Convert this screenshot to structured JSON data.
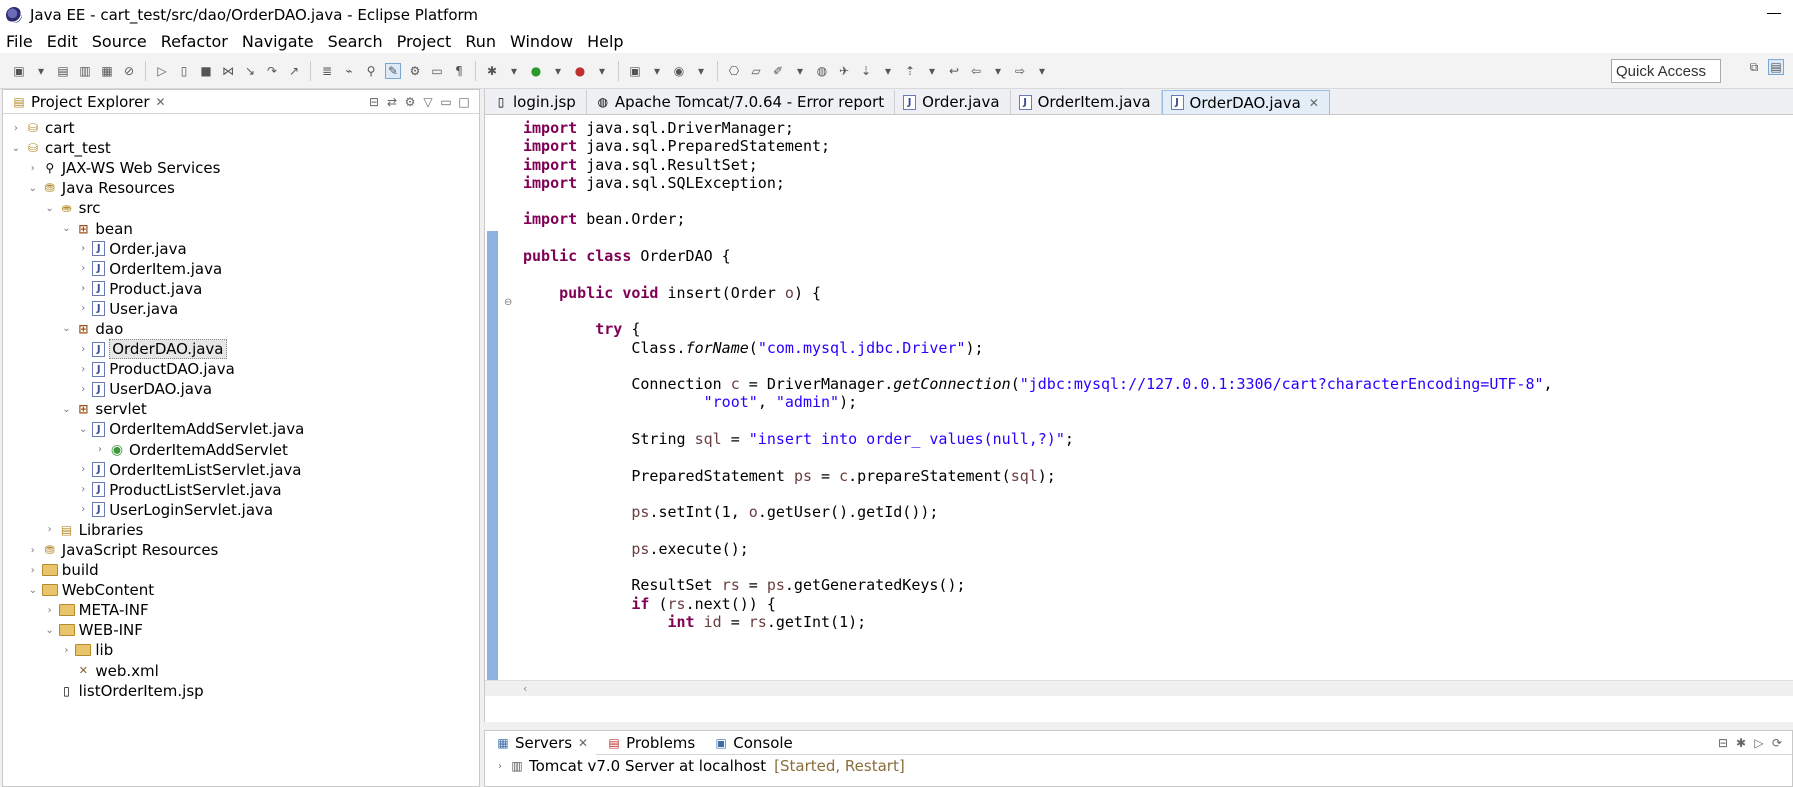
{
  "window": {
    "title": "Java EE - cart_test/src/dao/OrderDAO.java - Eclipse Platform"
  },
  "menu": [
    "File",
    "Edit",
    "Source",
    "Refactor",
    "Navigate",
    "Search",
    "Project",
    "Run",
    "Window",
    "Help"
  ],
  "toolbar": {
    "quick_access": "Quick Access"
  },
  "explorer": {
    "title": "Project Explorer",
    "tree": [
      {
        "label": "cart",
        "depth": 0,
        "toggle": "›",
        "icon": "project"
      },
      {
        "label": "cart_test",
        "depth": 0,
        "toggle": "⌄",
        "icon": "project"
      },
      {
        "label": "JAX-WS Web Services",
        "depth": 1,
        "toggle": "›",
        "icon": "webservice"
      },
      {
        "label": "Java Resources",
        "depth": 1,
        "toggle": "⌄",
        "icon": "resources"
      },
      {
        "label": "src",
        "depth": 2,
        "toggle": "⌄",
        "icon": "srcfolder"
      },
      {
        "label": "bean",
        "depth": 3,
        "toggle": "⌄",
        "icon": "package"
      },
      {
        "label": "Order.java",
        "depth": 4,
        "toggle": "›",
        "icon": "java"
      },
      {
        "label": "OrderItem.java",
        "depth": 4,
        "toggle": "›",
        "icon": "java"
      },
      {
        "label": "Product.java",
        "depth": 4,
        "toggle": "›",
        "icon": "java"
      },
      {
        "label": "User.java",
        "depth": 4,
        "toggle": "›",
        "icon": "java"
      },
      {
        "label": "dao",
        "depth": 3,
        "toggle": "⌄",
        "icon": "package"
      },
      {
        "label": "OrderDAO.java",
        "depth": 4,
        "toggle": "›",
        "icon": "java",
        "selected": true
      },
      {
        "label": "ProductDAO.java",
        "depth": 4,
        "toggle": "›",
        "icon": "java"
      },
      {
        "label": "UserDAO.java",
        "depth": 4,
        "toggle": "›",
        "icon": "java"
      },
      {
        "label": "servlet",
        "depth": 3,
        "toggle": "⌄",
        "icon": "package"
      },
      {
        "label": "OrderItemAddServlet.java",
        "depth": 4,
        "toggle": "⌄",
        "icon": "java"
      },
      {
        "label": "OrderItemAddServlet",
        "depth": 5,
        "toggle": "›",
        "icon": "class"
      },
      {
        "label": "OrderItemListServlet.java",
        "depth": 4,
        "toggle": "›",
        "icon": "java"
      },
      {
        "label": "ProductListServlet.java",
        "depth": 4,
        "toggle": "›",
        "icon": "java"
      },
      {
        "label": "UserLoginServlet.java",
        "depth": 4,
        "toggle": "›",
        "icon": "java"
      },
      {
        "label": "Libraries",
        "depth": 2,
        "toggle": "›",
        "icon": "library"
      },
      {
        "label": "JavaScript Resources",
        "depth": 1,
        "toggle": "›",
        "icon": "resources"
      },
      {
        "label": "build",
        "depth": 1,
        "toggle": "›",
        "icon": "folder"
      },
      {
        "label": "WebContent",
        "depth": 1,
        "toggle": "⌄",
        "icon": "folder"
      },
      {
        "label": "META-INF",
        "depth": 2,
        "toggle": "›",
        "icon": "folder"
      },
      {
        "label": "WEB-INF",
        "depth": 2,
        "toggle": "⌄",
        "icon": "folder"
      },
      {
        "label": "lib",
        "depth": 3,
        "toggle": "›",
        "icon": "folder"
      },
      {
        "label": "web.xml",
        "depth": 3,
        "toggle": "",
        "icon": "xml"
      },
      {
        "label": "listOrderItem.jsp",
        "depth": 2,
        "toggle": "",
        "icon": "jsp"
      }
    ]
  },
  "editor": {
    "tabs": [
      {
        "label": "login.jsp",
        "active": false
      },
      {
        "label": "Apache Tomcat/7.0.64 - Error report",
        "active": false
      },
      {
        "label": "Order.java",
        "active": false
      },
      {
        "label": "OrderItem.java",
        "active": false
      },
      {
        "label": "OrderDAO.java",
        "active": true
      }
    ],
    "lines": [
      [
        {
          "t": "import",
          "c": "kw"
        },
        {
          "t": " java.sql.DriverManager;"
        }
      ],
      [
        {
          "t": "import",
          "c": "kw"
        },
        {
          "t": " java.sql.PreparedStatement;"
        }
      ],
      [
        {
          "t": "import",
          "c": "kw"
        },
        {
          "t": " java.sql.ResultSet;"
        }
      ],
      [
        {
          "t": "import",
          "c": "kw"
        },
        {
          "t": " java.sql.SQLException;"
        }
      ],
      [],
      [
        {
          "t": "import",
          "c": "kw"
        },
        {
          "t": " bean.Order;"
        }
      ],
      [],
      [
        {
          "t": "public",
          "c": "kw"
        },
        {
          "t": " "
        },
        {
          "t": "class",
          "c": "kw"
        },
        {
          "t": " OrderDAO {"
        }
      ],
      [],
      [
        {
          "t": "    "
        },
        {
          "t": "public",
          "c": "kw"
        },
        {
          "t": " "
        },
        {
          "t": "void",
          "c": "kw"
        },
        {
          "t": " insert(Order "
        },
        {
          "t": "o",
          "c": "var"
        },
        {
          "t": ") {"
        }
      ],
      [],
      [
        {
          "t": "        "
        },
        {
          "t": "try",
          "c": "kw"
        },
        {
          "t": " {"
        }
      ],
      [
        {
          "t": "            Class."
        },
        {
          "t": "forName",
          "c": "it"
        },
        {
          "t": "("
        },
        {
          "t": "\"com.mysql.jdbc.Driver\"",
          "c": "str"
        },
        {
          "t": ");"
        }
      ],
      [],
      [
        {
          "t": "            Connection "
        },
        {
          "t": "c",
          "c": "var"
        },
        {
          "t": " = DriverManager."
        },
        {
          "t": "getConnection",
          "c": "it"
        },
        {
          "t": "("
        },
        {
          "t": "\"jdbc:mysql://127.0.0.1:3306/cart?characterEncoding=UTF-8\"",
          "c": "str"
        },
        {
          "t": ","
        }
      ],
      [
        {
          "t": "                    "
        },
        {
          "t": "\"root\"",
          "c": "str"
        },
        {
          "t": ", "
        },
        {
          "t": "\"admin\"",
          "c": "str"
        },
        {
          "t": ");"
        }
      ],
      [],
      [
        {
          "t": "            String "
        },
        {
          "t": "sql",
          "c": "var"
        },
        {
          "t": " = "
        },
        {
          "t": "\"insert into order_ values(null,?)\"",
          "c": "str"
        },
        {
          "t": ";"
        }
      ],
      [],
      [
        {
          "t": "            PreparedStatement "
        },
        {
          "t": "ps",
          "c": "var"
        },
        {
          "t": " = "
        },
        {
          "t": "c",
          "c": "var"
        },
        {
          "t": ".prepareStatement("
        },
        {
          "t": "sql",
          "c": "var"
        },
        {
          "t": ");"
        }
      ],
      [],
      [
        {
          "t": "            "
        },
        {
          "t": "ps",
          "c": "var"
        },
        {
          "t": ".setInt(1, "
        },
        {
          "t": "o",
          "c": "var"
        },
        {
          "t": ".getUser().getId());"
        }
      ],
      [],
      [
        {
          "t": "            "
        },
        {
          "t": "ps",
          "c": "var"
        },
        {
          "t": ".execute();"
        }
      ],
      [],
      [
        {
          "t": "            ResultSet "
        },
        {
          "t": "rs",
          "c": "var"
        },
        {
          "t": " = "
        },
        {
          "t": "ps",
          "c": "var"
        },
        {
          "t": ".getGeneratedKeys();"
        }
      ],
      [
        {
          "t": "            "
        },
        {
          "t": "if",
          "c": "kw"
        },
        {
          "t": " ("
        },
        {
          "t": "rs",
          "c": "var"
        },
        {
          "t": ".next()) {"
        }
      ],
      [
        {
          "t": "                "
        },
        {
          "t": "int",
          "c": "kw"
        },
        {
          "t": " "
        },
        {
          "t": "id",
          "c": "var"
        },
        {
          "t": " = "
        },
        {
          "t": "rs",
          "c": "var"
        },
        {
          "t": ".getInt(1);"
        }
      ]
    ]
  },
  "servers": {
    "tabs": [
      "Servers",
      "Problems",
      "Console"
    ],
    "server_name": "Tomcat v7.0 Server at localhost",
    "server_state": "[Started, Restart]"
  }
}
